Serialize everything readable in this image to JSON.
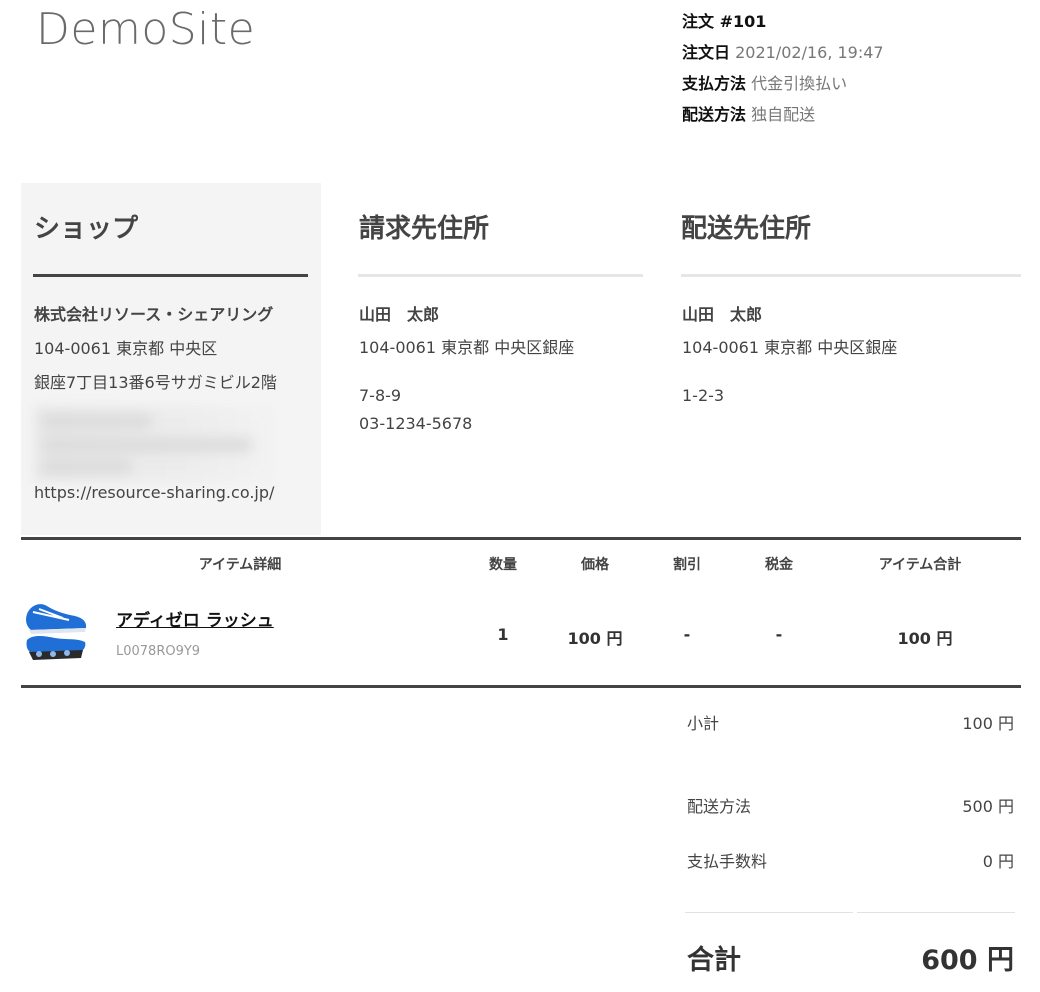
{
  "site": {
    "logo": "DemoSite"
  },
  "order": {
    "number_label": "注文 #101",
    "date_label": "注文日",
    "date_value": "2021/02/16, 19:47",
    "payment_label": "支払方法",
    "payment_value": "代金引換払い",
    "shipping_label": "配送方法",
    "shipping_value": "独自配送"
  },
  "shop": {
    "title": "ショップ",
    "company": "株式会社リソース・シェアリング",
    "address_line1": "104-0061 東京都 中央区",
    "address_line2": "銀座7丁目13番6号サガミビル2階",
    "url": "https://resource-sharing.co.jp/"
  },
  "billing": {
    "title": "請求先住所",
    "name": "山田　太郎",
    "address_line1": "104-0061 東京都 中央区銀座",
    "address_line2": "7-8-9",
    "phone": "03-1234-5678"
  },
  "shipping": {
    "title": "配送先住所",
    "name": "山田　太郎",
    "address_line1": "104-0061 東京都 中央区銀座",
    "address_line2": "1-2-3"
  },
  "table": {
    "headers": {
      "item": "アイテム詳細",
      "qty": "数量",
      "price": "価格",
      "discount": "割引",
      "tax": "税金",
      "total": "アイテム合計"
    },
    "rows": [
      {
        "name": "アディゼロ ラッシュ",
        "sku": "L0078RO9Y9",
        "qty": "1",
        "price": "100 円",
        "discount": "-",
        "tax": "-",
        "total": "100 円"
      }
    ]
  },
  "summary": {
    "subtotal_label": "小計",
    "subtotal_value": "100 円",
    "shipping_label": "配送方法",
    "shipping_value": "500 円",
    "fee_label": "支払手数料",
    "fee_value": "0 円",
    "total_label": "合計",
    "total_value": "600 円"
  },
  "colors": {
    "shop_panel_bg": "#f4f4f4",
    "shop_rule": "#444444",
    "address_rule": "#e6e6e6",
    "table_rule": "#444444"
  }
}
